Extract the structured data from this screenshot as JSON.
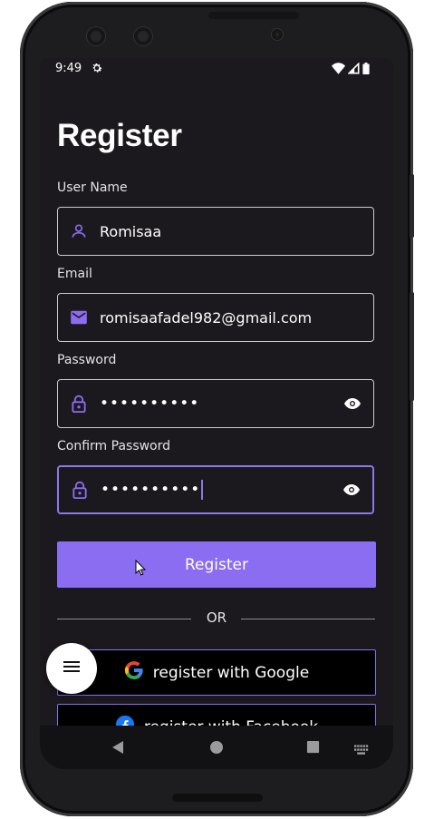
{
  "status_bar": {
    "time": "9:49",
    "icons": [
      "settings-icon",
      "wifi-icon",
      "signal-icon",
      "battery-icon"
    ]
  },
  "page": {
    "title": "Register"
  },
  "form": {
    "username": {
      "label": "User Name",
      "value": "Romisaa",
      "icon": "person-icon"
    },
    "email": {
      "label": "Email",
      "value": "romisaafadel982@gmail.com",
      "icon": "mail-icon"
    },
    "password": {
      "label": "Password",
      "value": "••••••••••",
      "icon": "lock-icon",
      "trailing_icon": "eye-icon"
    },
    "confirm_password": {
      "label": "Confirm Password",
      "value": "••••••••••",
      "icon": "lock-icon",
      "trailing_icon": "eye-icon"
    }
  },
  "actions": {
    "register_label": "Register",
    "or_label": "OR",
    "google_label": "register with Google",
    "facebook_label": "register with Facebook"
  },
  "fab": {
    "icon": "menu-icon"
  },
  "nav_bar": {
    "icons": [
      "back-icon",
      "home-icon",
      "recents-icon",
      "keyboard-icon"
    ]
  },
  "colors": {
    "accent": "#8b6df2",
    "focus_border": "#8f77e8",
    "background": "#1b191d",
    "field_border": "#cfc9d3"
  }
}
